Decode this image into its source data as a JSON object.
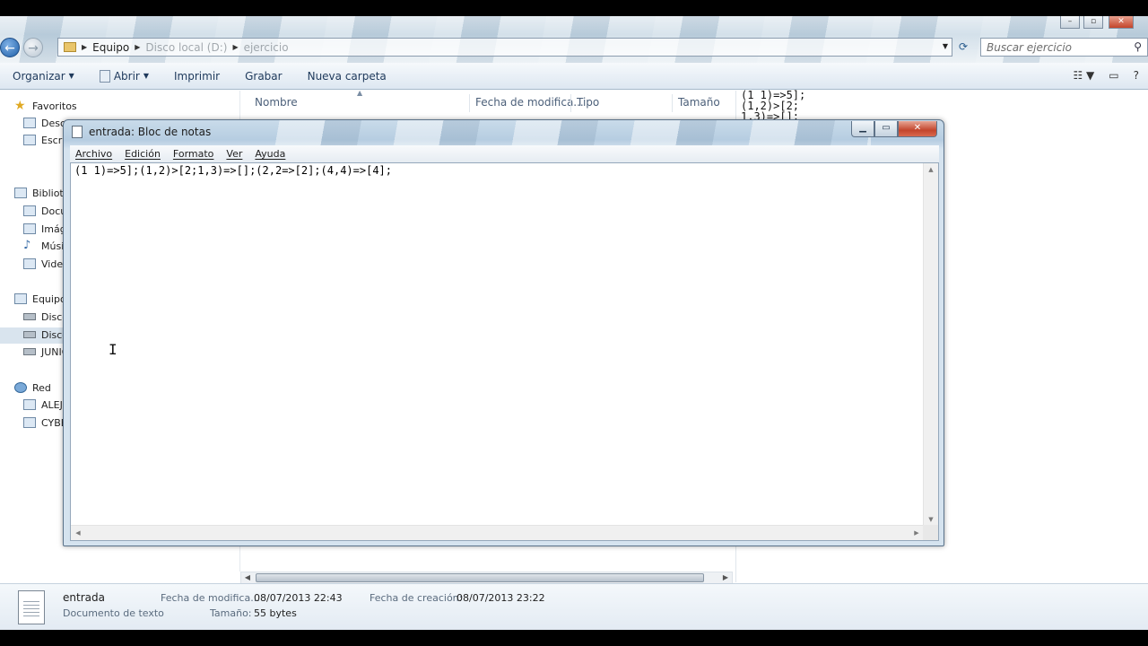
{
  "explorer": {
    "breadcrumb": [
      "Equipo",
      "Disco local (D:)",
      "ejercicio"
    ],
    "search_placeholder": "Buscar ejercicio",
    "toolbar": {
      "organize": "Organizar",
      "open": "Abrir",
      "print": "Imprimir",
      "burn": "Grabar",
      "new_folder": "Nueva carpeta"
    },
    "nav": {
      "favorites": "Favoritos",
      "downloads": "Descargas",
      "desktop": "Escritorio",
      "libraries": "Bibliotecas",
      "documents": "Documentos",
      "images": "Imágenes",
      "music": "Música",
      "videos": "Videos",
      "computer": "Equipo",
      "disk_c": "Disco local (C:)",
      "disk_d": "Disco local (D:)",
      "junior": "JUNIOR",
      "network": "Red",
      "alejo": "ALEJO",
      "cyber": "CYBER"
    },
    "columns": {
      "name": "Nombre",
      "modified": "Fecha de modifica...",
      "type": "Tipo",
      "size": "Tamaño"
    },
    "preview_text": "(1 1)=>5];\n(1,2)>[2;\n1,3)=>[];",
    "details": {
      "file_name": "entrada",
      "file_type": "Documento de texto",
      "modified_label": "Fecha de modifica...",
      "modified_value": "08/07/2013 22:43",
      "created_label": "Fecha de creación:",
      "created_value": "08/07/2013 23:22",
      "size_label": "Tamaño:",
      "size_value": "55 bytes"
    }
  },
  "notepad": {
    "title": "entrada: Bloc de notas",
    "menu": [
      "Archivo",
      "Edición",
      "Formato",
      "Ver",
      "Ayuda"
    ],
    "content": "(1 1)=>5];(1,2)>[2;1,3)=>[];(2,2=>[2];(4,4)=>[4];"
  }
}
